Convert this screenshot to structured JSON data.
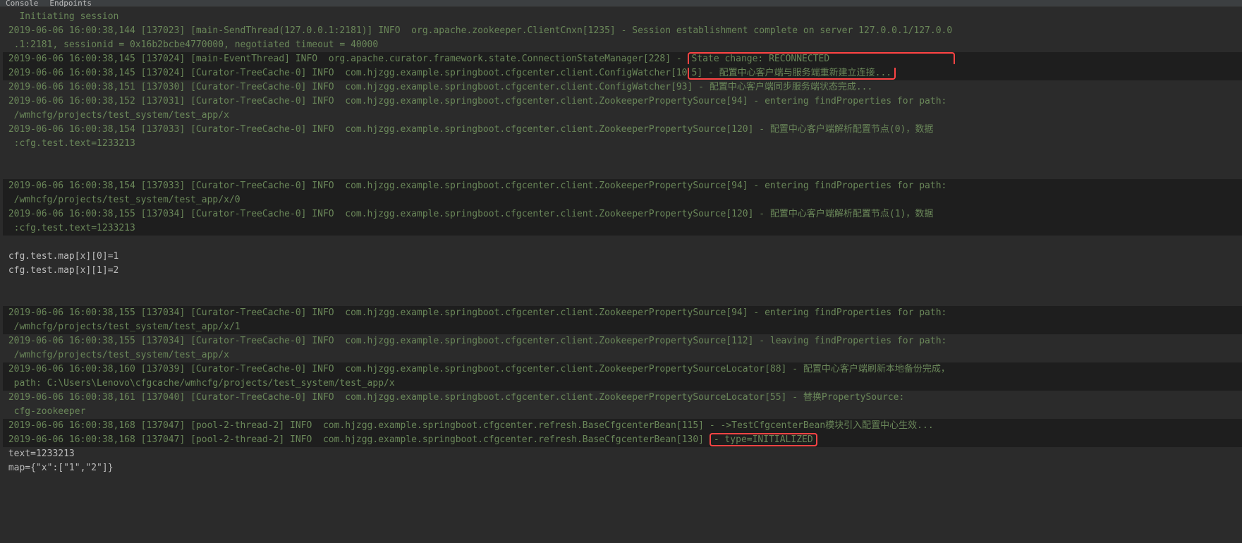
{
  "tabs": {
    "console": "Console",
    "endpoints": "Endpoints"
  },
  "lines": [
    {
      "cls": "green",
      "bg": "",
      "text": "   Initiating session"
    },
    {
      "cls": "green",
      "bg": "",
      "text": " 2019-06-06 16:00:38,144 [137023] [main-SendThread(127.0.0.1:2181)] INFO  org.apache.zookeeper.ClientCnxn[1235] - Session establishment complete on server 127.0.0.1/127.0.0"
    },
    {
      "cls": "green",
      "bg": "",
      "text": "  .1:2181, sessionid = 0x16b2bcbe4770000, negotiated timeout = 40000"
    },
    {
      "cls": "green",
      "bg": "black-bg",
      "pre": " 2019-06-06 16:00:38,145 [137024] [main-EventThread] INFO  org.apache.curator.framework.state.ConnectionStateManager[228] - ",
      "boxTopHalf": true,
      "boxText": "State change: RECONNECTED                      "
    },
    {
      "cls": "green",
      "bg": "black-bg",
      "pre": " 2019-06-06 16:00:38,145 [137024] [Curator-TreeCache-0] INFO  com.hjzgg.example.springboot.cfgcenter.client.ConfigWatcher[10",
      "boxBottomHalf": true,
      "boxText": "5] - 配置中心客户端与服务端重新建立连接..."
    },
    {
      "cls": "green",
      "bg": "",
      "text": " 2019-06-06 16:00:38,151 [137030] [Curator-TreeCache-0] INFO  com.hjzgg.example.springboot.cfgcenter.client.ConfigWatcher[93] - 配置中心客户端同步服务端状态完成..."
    },
    {
      "cls": "green",
      "bg": "",
      "text": " 2019-06-06 16:00:38,152 [137031] [Curator-TreeCache-0] INFO  com.hjzgg.example.springboot.cfgcenter.client.ZookeeperPropertySource[94] - entering findProperties for path: "
    },
    {
      "cls": "green",
      "bg": "",
      "text": "  /wmhcfg/projects/test_system/test_app/x"
    },
    {
      "cls": "green",
      "bg": "",
      "text": " 2019-06-06 16:00:38,154 [137033] [Curator-TreeCache-0] INFO  com.hjzgg.example.springboot.cfgcenter.client.ZookeeperPropertySource[120] - 配置中心客户端解析配置节点(0)，数据"
    },
    {
      "cls": "green",
      "bg": "",
      "text": "  :cfg.test.text=1233213"
    },
    {
      "cls": "green",
      "bg": "",
      "text": " "
    },
    {
      "cls": "green",
      "bg": "",
      "text": " "
    },
    {
      "cls": "green",
      "bg": "black-bg",
      "text": " 2019-06-06 16:00:38,154 [137033] [Curator-TreeCache-0] INFO  com.hjzgg.example.springboot.cfgcenter.client.ZookeeperPropertySource[94] - entering findProperties for path: "
    },
    {
      "cls": "green",
      "bg": "black-bg",
      "text": "  /wmhcfg/projects/test_system/test_app/x/0"
    },
    {
      "cls": "green",
      "bg": "black-bg",
      "text": " 2019-06-06 16:00:38,155 [137034] [Curator-TreeCache-0] INFO  com.hjzgg.example.springboot.cfgcenter.client.ZookeeperPropertySource[120] - 配置中心客户端解析配置节点(1)，数据"
    },
    {
      "cls": "green",
      "bg": "black-bg",
      "text": "  :cfg.test.text=1233213"
    },
    {
      "cls": "white",
      "bg": "",
      "text": " "
    },
    {
      "cls": "white",
      "bg": "",
      "text": " cfg.test.map[x][0]=1"
    },
    {
      "cls": "white",
      "bg": "",
      "text": " cfg.test.map[x][1]=2"
    },
    {
      "cls": "white",
      "bg": "",
      "text": " "
    },
    {
      "cls": "white",
      "bg": "",
      "text": " "
    },
    {
      "cls": "green",
      "bg": "black-bg",
      "text": " 2019-06-06 16:00:38,155 [137034] [Curator-TreeCache-0] INFO  com.hjzgg.example.springboot.cfgcenter.client.ZookeeperPropertySource[94] - entering findProperties for path: "
    },
    {
      "cls": "green",
      "bg": "black-bg",
      "text": "  /wmhcfg/projects/test_system/test_app/x/1"
    },
    {
      "cls": "green",
      "bg": "",
      "text": " 2019-06-06 16:00:38,155 [137034] [Curator-TreeCache-0] INFO  com.hjzgg.example.springboot.cfgcenter.client.ZookeeperPropertySource[112] - leaving findProperties for path: "
    },
    {
      "cls": "green",
      "bg": "",
      "text": "  /wmhcfg/projects/test_system/test_app/x"
    },
    {
      "cls": "green",
      "bg": "black-bg",
      "text": " 2019-06-06 16:00:38,160 [137039] [Curator-TreeCache-0] INFO  com.hjzgg.example.springboot.cfgcenter.client.ZookeeperPropertySourceLocator[88] - 配置中心客户端刷新本地备份完成，"
    },
    {
      "cls": "green",
      "bg": "black-bg",
      "text": "  path: C:\\Users\\Lenovo\\cfgcache/wmhcfg/projects/test_system/test_app/x"
    },
    {
      "cls": "green",
      "bg": "",
      "text": " 2019-06-06 16:00:38,161 [137040] [Curator-TreeCache-0] INFO  com.hjzgg.example.springboot.cfgcenter.client.ZookeeperPropertySourceLocator[55] - 替换PropertySource:"
    },
    {
      "cls": "green",
      "bg": "",
      "text": "  cfg-zookeeper"
    },
    {
      "cls": "green",
      "bg": "black-bg",
      "text": " 2019-06-06 16:00:38,168 [137047] [pool-2-thread-2] INFO  com.hjzgg.example.springboot.cfgcenter.refresh.BaseCfgcenterBean[115] - ->TestCfgcenterBean模块引入配置中心生效..."
    },
    {
      "cls": "green",
      "bg": "black-bg",
      "pre": " 2019-06-06 16:00:38,168 [137047] [pool-2-thread-2] INFO  com.hjzgg.example.springboot.cfgcenter.refresh.BaseCfgcenterBean[130] ",
      "boxSingle": true,
      "boxText": "- type=INITIALIZED"
    },
    {
      "cls": "white",
      "bg": "",
      "text": " text=1233213"
    },
    {
      "cls": "white",
      "bg": "",
      "text": " map={\"x\":[\"1\",\"2\"]}"
    }
  ]
}
